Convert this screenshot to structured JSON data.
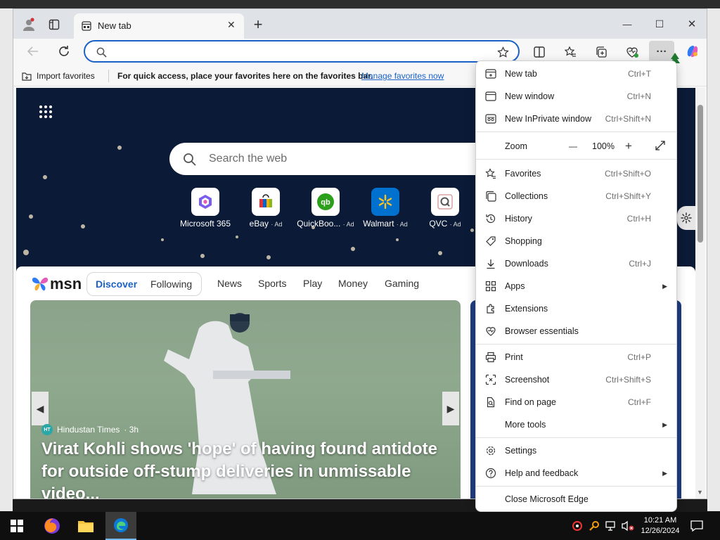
{
  "tab": {
    "title": "New tab",
    "close": "✕"
  },
  "window_controls": {
    "minimize": "—",
    "maximize": "☐",
    "close": "✕"
  },
  "new_tab_glyph": "+",
  "address": {
    "placeholder": ""
  },
  "favbar": {
    "import_label": "Import favorites",
    "hint": "For quick access, place your favorites here on the favorites bar.",
    "manage_link": "Manage favorites now",
    "link_color": "#1a62c8"
  },
  "newtab": {
    "search_placeholder": "Search the web",
    "sites": [
      {
        "label": "Microsoft 365",
        "ad": ""
      },
      {
        "label": "eBay",
        "ad": "· Ad"
      },
      {
        "label": "QuickBoo...",
        "ad": "· Ad"
      },
      {
        "label": "Walmart",
        "ad": "· Ad"
      },
      {
        "label": "QVC",
        "ad": "· Ad"
      }
    ]
  },
  "msn": {
    "logo": "msn",
    "tabs": [
      "Discover",
      "Following"
    ],
    "nav": [
      "News",
      "Sports",
      "Play",
      "Money",
      "Gaming"
    ],
    "accent": "#1a62c8"
  },
  "hero": {
    "source": "Hindustan Times",
    "age": "· 3h",
    "headline": "Virat Kohli shows 'hope' of having found antidote for outside off-stump deliveries in unmissable video..."
  },
  "menu": {
    "items": [
      {
        "label": "New tab",
        "shortcut": "Ctrl+T"
      },
      {
        "label": "New window",
        "shortcut": "Ctrl+N"
      },
      {
        "label": "New InPrivate window",
        "shortcut": "Ctrl+Shift+N"
      },
      {
        "label": "Zoom",
        "zoom_out": "—",
        "value": "100%",
        "zoom_in": "+"
      },
      {
        "label": "Favorites",
        "shortcut": "Ctrl+Shift+O"
      },
      {
        "label": "Collections",
        "shortcut": "Ctrl+Shift+Y"
      },
      {
        "label": "History",
        "shortcut": "Ctrl+H"
      },
      {
        "label": "Shopping",
        "shortcut": ""
      },
      {
        "label": "Downloads",
        "shortcut": "Ctrl+J"
      },
      {
        "label": "Apps",
        "shortcut": ""
      },
      {
        "label": "Extensions",
        "shortcut": ""
      },
      {
        "label": "Browser essentials",
        "shortcut": ""
      },
      {
        "label": "Print",
        "shortcut": "Ctrl+P"
      },
      {
        "label": "Screenshot",
        "shortcut": "Ctrl+Shift+S"
      },
      {
        "label": "Find on page",
        "shortcut": "Ctrl+F"
      },
      {
        "label": "More tools",
        "shortcut": ""
      },
      {
        "label": "Settings",
        "shortcut": ""
      },
      {
        "label": "Help and feedback",
        "shortcut": ""
      },
      {
        "label": "Close Microsoft Edge",
        "shortcut": ""
      }
    ]
  },
  "taskbar": {
    "time": "10:21 AM",
    "date": "12/26/2024"
  }
}
